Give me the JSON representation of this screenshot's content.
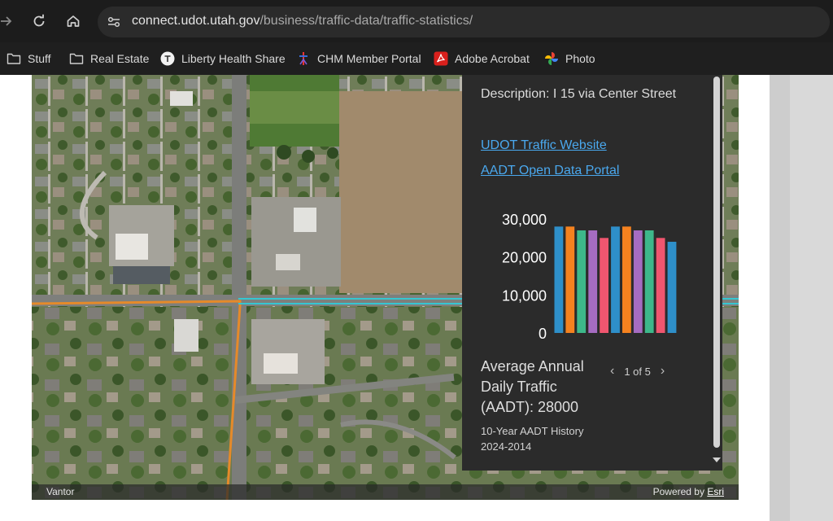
{
  "browser": {
    "url_host": "connect.udot.utah.gov",
    "url_path": "/business/traffic-data/traffic-statistics/",
    "bookmarks": [
      {
        "label": "Stuff",
        "icon": "folder-icon"
      },
      {
        "label": "Real Estate",
        "icon": "folder-icon"
      },
      {
        "label": "Liberty Health Share",
        "icon": "liberty-logo-icon"
      },
      {
        "label": "CHM Member Portal",
        "icon": "chm-logo-icon"
      },
      {
        "label": "Adobe Acrobat",
        "icon": "acrobat-icon"
      },
      {
        "label": "Photo",
        "icon": "photos-pinwheel-icon"
      }
    ]
  },
  "map": {
    "attribution_left": "Vantor",
    "powered_by": "Powered by",
    "powered_by_link": "Esri"
  },
  "popup": {
    "description": "Description: I 15 via Center Street",
    "link_website": "UDOT Traffic Website",
    "link_portal": "AADT Open Data Portal",
    "aadt_label": "Average Annual Daily Traffic (AADT): 28000",
    "pager": "1 of 5",
    "history_title": "10-Year AADT History",
    "history_range": "2024-2014"
  },
  "chart_data": {
    "type": "bar",
    "title": "",
    "xlabel": "",
    "ylabel": "",
    "ylim": [
      0,
      30000
    ],
    "yticks": [
      "30,000",
      "20,000",
      "10,000",
      "0"
    ],
    "values": [
      28000,
      28000,
      27000,
      27000,
      25000,
      28000,
      28000,
      27000,
      27000,
      25000,
      24000
    ],
    "colors": [
      "#2e8fc9",
      "#f5821f",
      "#3db88a",
      "#a56cc1",
      "#f0566f",
      "#2e8fc9",
      "#f5821f",
      "#a56cc1",
      "#3db88a",
      "#f0566f",
      "#2e8fc9"
    ]
  }
}
